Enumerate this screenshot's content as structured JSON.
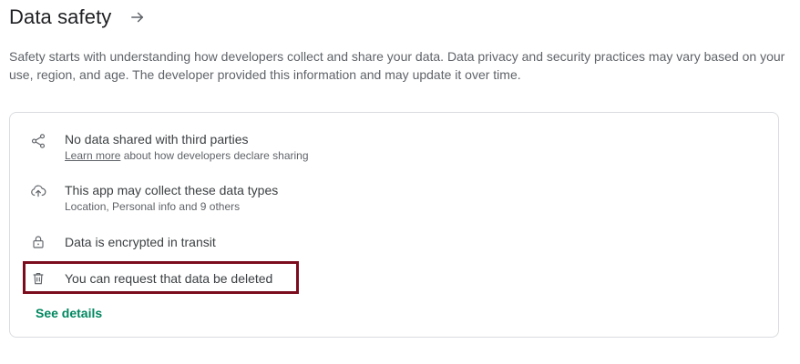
{
  "section": {
    "title": "Data safety",
    "description": "Safety starts with understanding how developers collect and share your data. Data privacy and security practices may vary based on your use, region, and age. The developer provided this information and may update it over time."
  },
  "items": [
    {
      "icon": "share-icon",
      "primary": "No data shared with third parties",
      "link": "Learn more",
      "secondary_suffix": " about how developers declare sharing"
    },
    {
      "icon": "cloud-upload-icon",
      "primary": "This app may collect these data types",
      "secondary": "Location, Personal info and 9 others"
    },
    {
      "icon": "lock-icon",
      "primary": "Data is encrypted in transit"
    },
    {
      "icon": "trash-icon",
      "primary": "You can request that data be deleted"
    }
  ],
  "see_details": "See details",
  "colors": {
    "link_green": "#01875f",
    "highlight_border": "#7b0c1e",
    "card_border": "#dadce0"
  }
}
